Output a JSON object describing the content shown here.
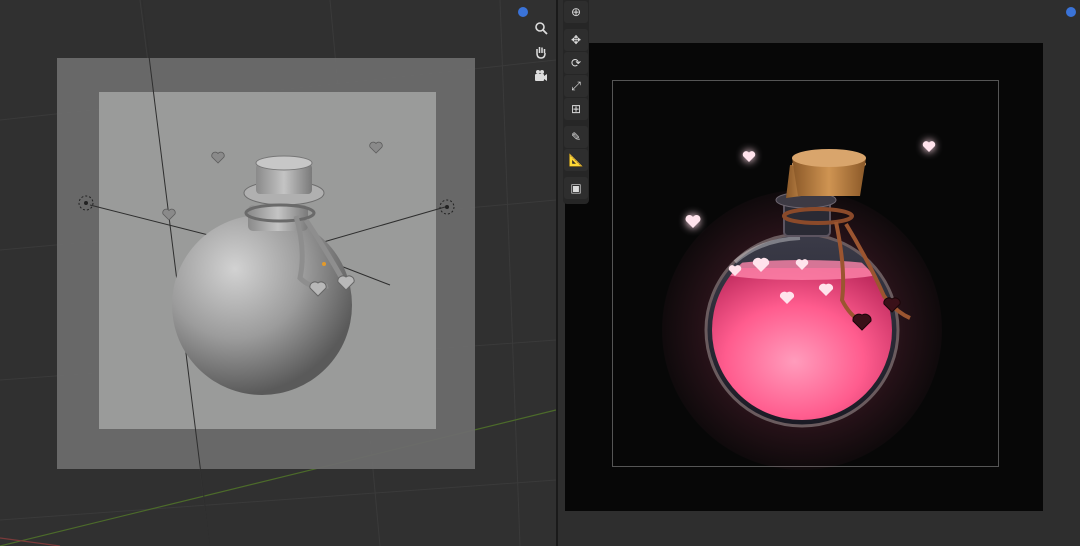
{
  "app": "Blender",
  "colors": {
    "viewport_bg": "#303030",
    "camera_passepartout": "#6b6b6b",
    "camera_frame": "#9a9b9a",
    "render_bg": "#070707",
    "potion_pink": "#ff5c8e",
    "cork": "#b57a3e",
    "accent_blue": "#3a73d8"
  },
  "left_viewport": {
    "mode": "solid",
    "nav_icons": [
      "zoom-icon",
      "pan-hand-icon",
      "camera-view-icon"
    ]
  },
  "right_viewport": {
    "mode": "rendered",
    "toolbar_tools": [
      "cursor-tool-icon",
      "move-tool-icon",
      "rotate-tool-icon",
      "scale-tool-icon",
      "transform-tool-icon",
      "annotate-tool-icon",
      "measure-tool-icon",
      "add-cube-tool-icon"
    ]
  }
}
